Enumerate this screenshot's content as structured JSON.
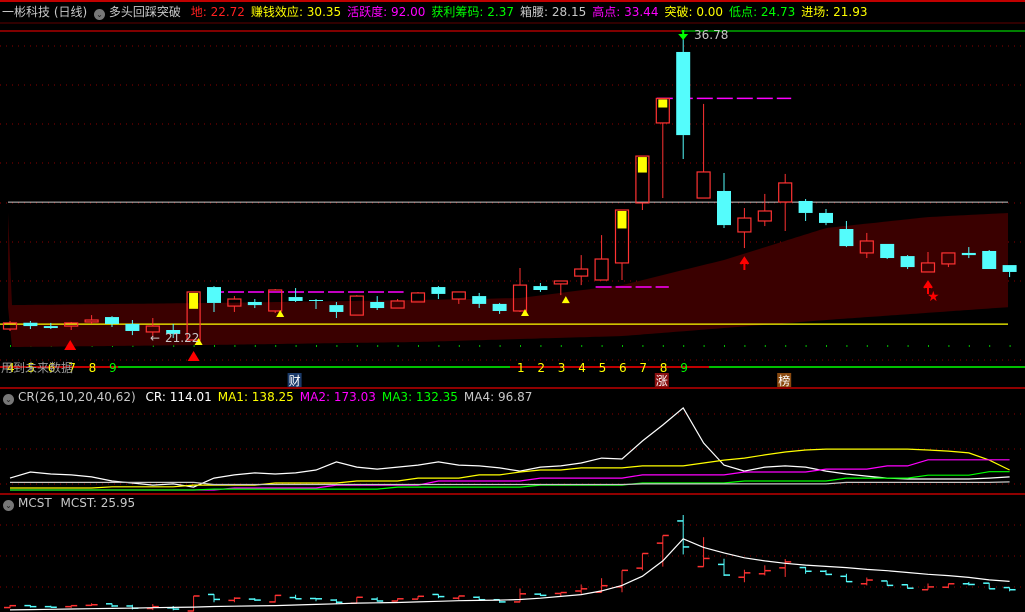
{
  "header": {
    "stock": "一彬科技 (日线)",
    "indicator": "多头回踩突破",
    "items": [
      {
        "label": "地",
        "value": "22.72",
        "color": "#ff2020"
      },
      {
        "label": "赚钱效应",
        "value": "30.35",
        "color": "#ffff00"
      },
      {
        "label": "活跃度",
        "value": "92.00",
        "color": "#ff00ff"
      },
      {
        "label": "获利筹码",
        "value": "2.37",
        "color": "#00ff00"
      },
      {
        "label": "箱腰",
        "value": "28.15",
        "color": "#c8c8c8"
      },
      {
        "label": "高点",
        "value": "33.44",
        "color": "#ff00ff"
      },
      {
        "label": "突破",
        "value": "0.00",
        "color": "#ffff00"
      },
      {
        "label": "低点",
        "value": "24.73",
        "color": "#00ff00"
      },
      {
        "label": "进场",
        "value": "21.93",
        "color": "#ffff00"
      }
    ]
  },
  "main_chart": {
    "high_label": "36.78",
    "low_label": "21.22",
    "warning_text": "用到未来数据",
    "colors": {
      "up": "#ff3232",
      "down": "#54fcfc",
      "band": "#3a0000",
      "box_mid": "#c8c8c8",
      "entry": "#ffff00"
    },
    "candles": [
      [
        21.68,
        22.09,
        21.58,
        21.99
      ],
      [
        22.0,
        22.09,
        21.68,
        21.83
      ],
      [
        21.83,
        21.99,
        21.68,
        21.73
      ],
      [
        21.83,
        22.04,
        21.63,
        21.99
      ],
      [
        22.04,
        22.39,
        21.94,
        22.14
      ],
      [
        22.29,
        22.34,
        21.78,
        21.94
      ],
      [
        21.94,
        22.14,
        21.37,
        21.58
      ],
      [
        21.53,
        22.24,
        21.27,
        21.83
      ],
      [
        21.63,
        21.94,
        21.22,
        21.43
      ],
      [
        21.12,
        23.57,
        21.07,
        23.57
      ],
      [
        23.82,
        23.87,
        22.55,
        23.01
      ],
      [
        22.85,
        23.36,
        22.55,
        23.21
      ],
      [
        23.06,
        23.21,
        22.75,
        22.9
      ],
      [
        22.6,
        23.72,
        22.5,
        23.67
      ],
      [
        23.31,
        23.77,
        23.06,
        23.11
      ],
      [
        23.16,
        23.21,
        22.7,
        23.11
      ],
      [
        22.9,
        23.06,
        22.24,
        22.55
      ],
      [
        22.39,
        23.41,
        22.39,
        23.36
      ],
      [
        23.06,
        23.36,
        22.65,
        22.75
      ],
      [
        22.75,
        23.21,
        22.75,
        23.11
      ],
      [
        23.06,
        23.57,
        23.06,
        23.52
      ],
      [
        23.82,
        23.87,
        23.21,
        23.47
      ],
      [
        23.21,
        23.57,
        22.96,
        23.57
      ],
      [
        23.36,
        23.52,
        22.75,
        22.96
      ],
      [
        22.96,
        23.01,
        22.45,
        22.6
      ],
      [
        22.6,
        24.79,
        22.55,
        23.92
      ],
      [
        23.87,
        24.03,
        23.57,
        23.67
      ],
      [
        23.98,
        24.13,
        23.41,
        24.13
      ],
      [
        24.38,
        25.45,
        23.92,
        24.74
      ],
      [
        24.18,
        26.47,
        24.18,
        25.25
      ],
      [
        25.05,
        27.75,
        24.18,
        27.75
      ],
      [
        28.11,
        30.5,
        27.75,
        30.5
      ],
      [
        32.19,
        33.44,
        28.36,
        33.44
      ],
      [
        35.81,
        36.78,
        30.35,
        31.57
      ],
      [
        28.36,
        33.16,
        28.36,
        29.69
      ],
      [
        28.72,
        29.64,
        26.83,
        26.98
      ],
      [
        26.63,
        27.85,
        25.81,
        27.34
      ],
      [
        27.19,
        28.57,
        26.93,
        27.7
      ],
      [
        28.16,
        29.59,
        26.68,
        29.13
      ],
      [
        28.21,
        28.31,
        27.19,
        27.6
      ],
      [
        27.6,
        27.8,
        26.98,
        27.09
      ],
      [
        26.78,
        27.19,
        25.86,
        25.91
      ],
      [
        25.56,
        26.58,
        25.3,
        26.17
      ],
      [
        26.02,
        26.02,
        25.25,
        25.3
      ],
      [
        25.4,
        25.45,
        24.74,
        24.84
      ],
      [
        24.59,
        25.61,
        24.59,
        25.05
      ],
      [
        25.0,
        25.56,
        24.84,
        25.56
      ],
      [
        25.56,
        25.86,
        25.3,
        25.45
      ],
      [
        25.66,
        25.71,
        24.74,
        24.74
      ],
      [
        24.94,
        24.94,
        24.33,
        24.59
      ]
    ],
    "yellow_top_candles": [
      9,
      30,
      31,
      32
    ],
    "band_upper": {
      "idx": [
        0,
        10,
        20,
        25,
        30,
        35,
        40,
        45,
        49
      ],
      "price": [
        22.9,
        23.01,
        23.16,
        23.26,
        23.92,
        25.2,
        26.83,
        27.39,
        27.6
      ]
    },
    "band_lower": {
      "idx": [
        0,
        10,
        20,
        30,
        40,
        49
      ],
      "price": [
        20.76,
        20.87,
        21.02,
        21.32,
        22.14,
        22.8
      ]
    },
    "box_mid_price": 28.15,
    "entry_price": 21.93,
    "resistance_segments": [
      {
        "from": 10,
        "to": 19,
        "price": 23.57
      },
      {
        "from": 29,
        "to": 32,
        "price": 23.82
      },
      {
        "from": 32,
        "to": 38,
        "price": 33.44
      }
    ],
    "count_markers": [
      {
        "idx": 0,
        "text": "4",
        "color": "#ffff00"
      },
      {
        "idx": 1,
        "text": "5",
        "color": "#ffff00"
      },
      {
        "idx": 2,
        "text": "6",
        "color": "#ffff00"
      },
      {
        "idx": 3,
        "text": "7",
        "color": "#ffff00"
      },
      {
        "idx": 4,
        "text": "8",
        "color": "#ffff00"
      },
      {
        "idx": 5,
        "text": "9",
        "color": "#00ff00"
      },
      {
        "idx": 25,
        "text": "1",
        "color": "#ffff00"
      },
      {
        "idx": 26,
        "text": "2",
        "color": "#ffff00"
      },
      {
        "idx": 27,
        "text": "3",
        "color": "#ffff00"
      },
      {
        "idx": 28,
        "text": "4",
        "color": "#ffff00"
      },
      {
        "idx": 29,
        "text": "5",
        "color": "#ffff00"
      },
      {
        "idx": 30,
        "text": "6",
        "color": "#ffff00"
      },
      {
        "idx": 31,
        "text": "7",
        "color": "#ffff00"
      },
      {
        "idx": 32,
        "text": "8",
        "color": "#ffff00"
      },
      {
        "idx": 33,
        "text": "9",
        "color": "#00ff00"
      }
    ],
    "badges": [
      {
        "idx": 14,
        "text": "财",
        "bg": "#1a3a6a"
      },
      {
        "idx": 32,
        "text": "涨",
        "bg": "#8a1010"
      },
      {
        "idx": 38,
        "text": "榜",
        "bg": "#8a4a10"
      }
    ],
    "buy_triangles": [
      3,
      9
    ],
    "small_triangles": [
      9,
      13,
      25,
      27
    ],
    "up_arrows": [
      36,
      45
    ],
    "star_idx": 45,
    "top_arrow_idx": 33
  },
  "cr_panel": {
    "title": "CR(26,10,20,40,62)",
    "values": [
      {
        "label": "CR",
        "value": "114.01",
        "color": "#ffffff"
      },
      {
        "label": "MA1",
        "value": "138.25",
        "color": "#ffff00"
      },
      {
        "label": "MA2",
        "value": "173.03",
        "color": "#ff00ff"
      },
      {
        "label": "MA3",
        "value": "132.35",
        "color": "#00ff00"
      },
      {
        "label": "MA4",
        "value": "96.87",
        "color": "#c8c8c8"
      }
    ],
    "series": {
      "CR": [
        110,
        131,
        124,
        121,
        114,
        100,
        93,
        86,
        90,
        79,
        110,
        121,
        128,
        124,
        128,
        138,
        166,
        148,
        141,
        148,
        155,
        166,
        155,
        152,
        145,
        134,
        148,
        152,
        162,
        179,
        176,
        238,
        293,
        352,
        231,
        155,
        134,
        148,
        152,
        148,
        134,
        124,
        117,
        110,
        107,
        107,
        107,
        107,
        110,
        114
      ],
      "MA1": [
        76,
        76,
        76,
        76,
        76,
        80,
        80,
        80,
        80,
        86,
        86,
        86,
        86,
        93,
        93,
        93,
        93,
        100,
        100,
        100,
        110,
        110,
        110,
        121,
        121,
        131,
        138,
        138,
        145,
        145,
        145,
        152,
        152,
        152,
        162,
        172,
        179,
        190,
        200,
        207,
        210,
        210,
        210,
        210,
        210,
        207,
        203,
        197,
        172,
        138
      ],
      "MA2": [
        62,
        62,
        62,
        62,
        62,
        62,
        66,
        66,
        66,
        66,
        66,
        76,
        76,
        76,
        76,
        76,
        86,
        86,
        86,
        86,
        86,
        100,
        100,
        100,
        100,
        100,
        110,
        110,
        110,
        110,
        110,
        121,
        121,
        121,
        121,
        121,
        131,
        131,
        131,
        131,
        141,
        141,
        141,
        152,
        152,
        173,
        173,
        173,
        173,
        173
      ],
      "MA3": [
        66,
        66,
        66,
        66,
        66,
        66,
        66,
        66,
        66,
        66,
        72,
        72,
        72,
        72,
        72,
        72,
        72,
        72,
        72,
        79,
        79,
        79,
        79,
        79,
        79,
        79,
        86,
        86,
        86,
        86,
        86,
        93,
        93,
        93,
        93,
        93,
        100,
        100,
        100,
        100,
        100,
        110,
        110,
        110,
        110,
        120,
        120,
        120,
        132,
        132
      ],
      "MA4": [
        95,
        95,
        95,
        95,
        95,
        95,
        95,
        95,
        95,
        95,
        88,
        88,
        88,
        88,
        88,
        88,
        88,
        88,
        88,
        88,
        88,
        88,
        88,
        88,
        88,
        88,
        88,
        88,
        88,
        88,
        88,
        90,
        90,
        90,
        90,
        90,
        90,
        90,
        90,
        90,
        90,
        95,
        95,
        95,
        95,
        95,
        95,
        95,
        95,
        97
      ]
    }
  },
  "mcst_panel": {
    "title": "MCST",
    "value_label": "MCST",
    "value": "25.95",
    "mcst": [
      21.3,
      21.35,
      21.4,
      21.45,
      21.5,
      21.55,
      21.6,
      21.65,
      21.7,
      21.75,
      21.85,
      21.9,
      21.95,
      22.0,
      22.1,
      22.2,
      22.3,
      22.4,
      22.45,
      22.5,
      22.6,
      22.7,
      22.8,
      22.85,
      22.9,
      23.0,
      23.2,
      23.5,
      23.8,
      24.4,
      25.3,
      26.8,
      29.3,
      32.9,
      31.5,
      30.6,
      29.8,
      29.3,
      28.9,
      28.6,
      28.4,
      28.2,
      27.9,
      27.7,
      27.4,
      27.1,
      26.9,
      26.6,
      26.2,
      25.95
    ]
  }
}
